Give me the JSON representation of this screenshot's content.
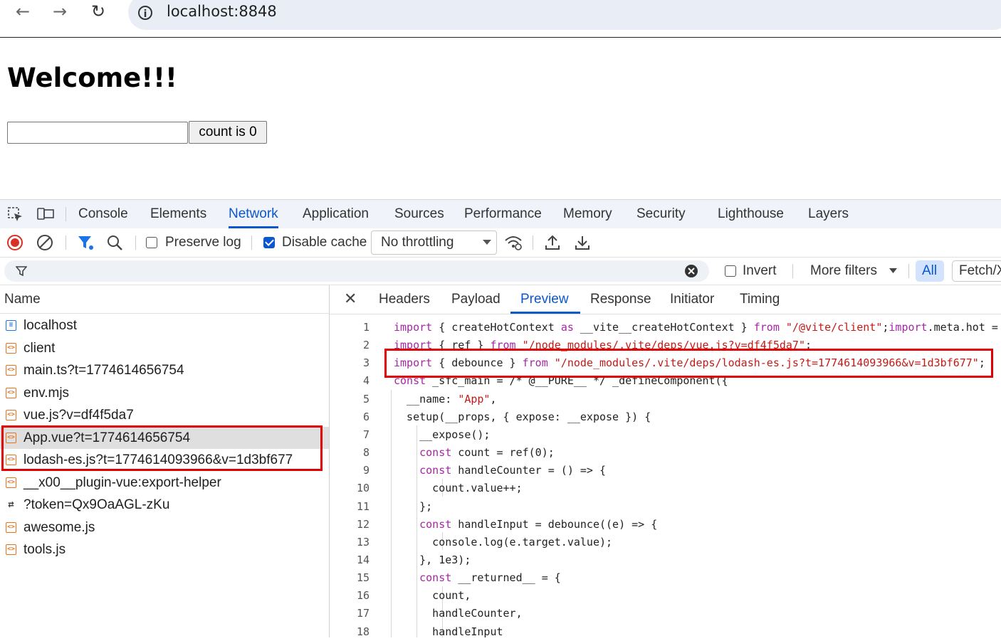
{
  "browser": {
    "back_icon": "arrow-left-icon",
    "forward_icon": "arrow-right-icon",
    "reload_icon": "reload-icon",
    "url": "localhost:8848"
  },
  "page": {
    "heading": "Welcome!!!",
    "input_value": "",
    "count_button": "count is 0"
  },
  "devtools": {
    "tabs": [
      "Console",
      "Elements",
      "Network",
      "Application",
      "Sources",
      "Performance",
      "Memory",
      "Security",
      "Lighthouse",
      "Layers"
    ],
    "active_tab": "Network",
    "toolbar": {
      "preserve_log": "Preserve log",
      "preserve_log_checked": false,
      "disable_cache": "Disable cache",
      "disable_cache_checked": true,
      "throttling": "No throttling"
    },
    "filter": {
      "placeholder": "",
      "invert": "Invert",
      "more_filters": "More filters",
      "all": "All",
      "fetch": "Fetch/X"
    },
    "name_header": "Name",
    "requests": [
      {
        "name": "localhost",
        "type": "document"
      },
      {
        "name": "client",
        "type": "script"
      },
      {
        "name": "main.ts?t=1774614656754",
        "type": "script"
      },
      {
        "name": "env.mjs",
        "type": "script"
      },
      {
        "name": "vue.js?v=df4f5da7",
        "type": "script"
      },
      {
        "name": "App.vue?t=1774614656754",
        "type": "script"
      },
      {
        "name": "lodash-es.js?t=1774614093966&v=1d3bf677",
        "type": "script"
      },
      {
        "name": "__x00__plugin-vue:export-helper",
        "type": "script"
      },
      {
        "name": "?token=Qx9OaAGL-zKu",
        "type": "websocket"
      },
      {
        "name": "awesome.js",
        "type": "script"
      },
      {
        "name": "tools.js",
        "type": "script"
      }
    ],
    "selected_request": "App.vue?t=1774614656754",
    "sub_tabs": [
      "Headers",
      "Payload",
      "Preview",
      "Response",
      "Initiator",
      "Timing"
    ],
    "active_sub_tab": "Preview",
    "code_lines": [
      "import { createHotContext as __vite__createHotContext } from \"/@vite/client\";import.meta.hot =",
      "import { ref } from \"/node_modules/.vite/deps/vue.js?v=df4f5da7\";",
      "import { debounce } from \"/node_modules/.vite/deps/lodash-es.js?t=1774614093966&v=1d3bf677\";",
      "const _sfc_main = /* @__PURE__ */ _defineComponent({",
      "  __name: \"App\",",
      "  setup(__props, { expose: __expose }) {",
      "    __expose();",
      "    const count = ref(0);",
      "    const handleCounter = () => {",
      "      count.value++;",
      "    };",
      "    const handleInput = debounce((e) => {",
      "      console.log(e.target.value);",
      "    }, 1e3);",
      "    const __returned__ = {",
      "      count,",
      "      handleCounter,",
      "      handleInput"
    ],
    "highlight_colors": {
      "annotation": "#e00000",
      "accent": "#0b57d0"
    }
  }
}
